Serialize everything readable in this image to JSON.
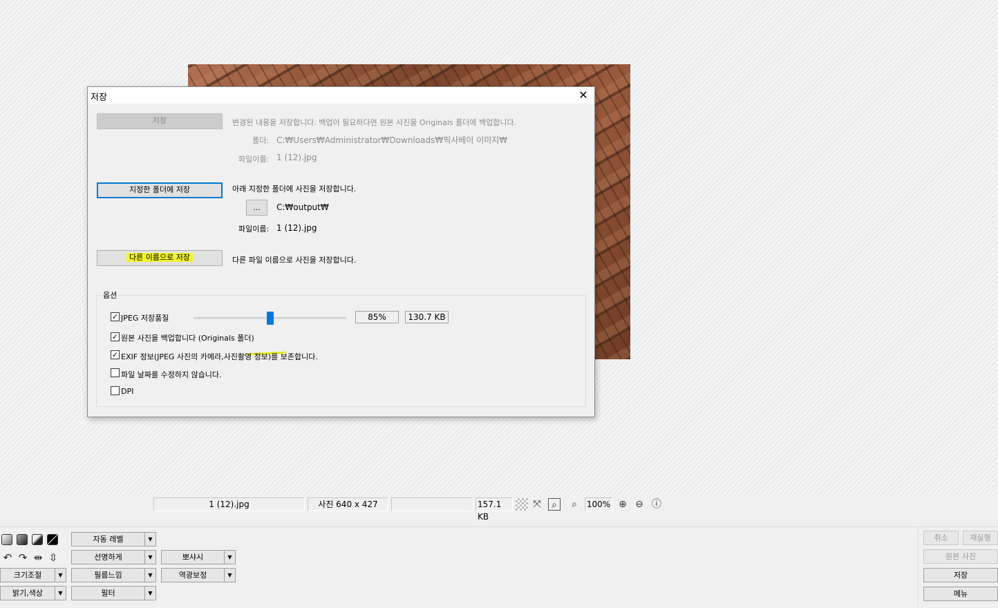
{
  "dialog": {
    "title": "저장",
    "close_glyph": "✕",
    "save": {
      "button_label": "저장",
      "description": "변경된 내용을 저장합니다. 백업이 필요하다면 원본 사진을 Originals 폴더에 백업합니다.",
      "folder_label": "폴더:",
      "folder_value": "C:₩Users₩Administrator₩Downloads₩픽사베이 이미지₩",
      "filename_label": "파일이름:",
      "filename_value": "1 (12).jpg"
    },
    "save_to_folder": {
      "button_label": "지정한 폴더에 저장",
      "description": "아래 지정한 폴더에 사진을 저장합니다.",
      "browse_label": "...",
      "folder_value": "C:₩output₩",
      "filename_label": "파일이름:",
      "filename_value": "1 (12).jpg"
    },
    "save_as": {
      "button_label": "다른 이름으로 저장",
      "description": "다른 파일 이름으로 사진을 저장합니다."
    },
    "options": {
      "legend": "옵션",
      "jpeg_quality_label": "JPEG 저장품질",
      "jpeg_quality_value": "85%",
      "jpeg_quality_fraction": 0.5,
      "estimated_size": "130.7 KB",
      "backup_original_label": "원본 사진을 백업합니다 (Originals 폴더)",
      "keep_exif_label": "EXIF 정보(JPEG 사진의 카메라,사진촬영 정보)를 보존합니다.",
      "keep_file_date_label": "파일 날짜를 수정하지 않습니다.",
      "dpi_label": "DPI",
      "check_glyph": "✓"
    }
  },
  "statusbar": {
    "filename": "1 (12).jpg",
    "dimensions": "사진 640 x 427",
    "empty": "",
    "filesize": "157.1 KB",
    "zoom": "100%"
  },
  "toolbar": {
    "auto_level": "자동 레벨",
    "sharpen": "선명하게",
    "film_look": "필름느낌",
    "filter": "필터",
    "resize": "크기조절",
    "brightness_color": "밝기,색상",
    "vignette": "뽀샤시",
    "backlight": "역광보정",
    "cancel": "취소",
    "redo": "재실행",
    "original_photo": "원본 사진",
    "save": "저장",
    "menu": "메뉴",
    "dropdown_glyph": "▼"
  },
  "colors": {
    "accent": "#0078d7",
    "highlight": "#f4f42a"
  }
}
